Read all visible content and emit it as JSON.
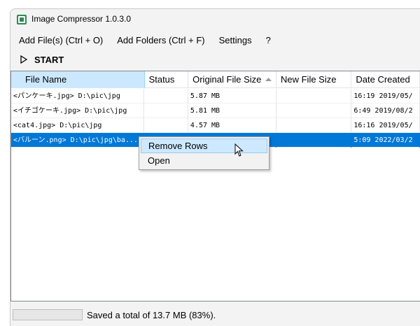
{
  "window": {
    "title": "Image Compressor 1.0.3.0"
  },
  "menu": {
    "items": [
      "Add File(s) (Ctrl + O)",
      "Add Folders (Ctrl + F)",
      "Settings",
      "?"
    ]
  },
  "toolbar": {
    "start_label": "START"
  },
  "table": {
    "columns": [
      "File Name",
      "Status",
      "Original File Size",
      "New File Size",
      "Date Created"
    ],
    "sorted_column": "Original File Size",
    "rows": [
      {
        "name": "<パンケーキ.jpg> D:\\pic\\jpg",
        "status": "",
        "original": "5.87 MB",
        "new": "",
        "date": "16:19 2019/05/"
      },
      {
        "name": "<イチゴケーキ.jpg> D:\\pic\\jpg",
        "status": "",
        "original": "5.81 MB",
        "new": "",
        "date": "6:49 2019/08/2"
      },
      {
        "name": "<cat4.jpg> D:\\pic\\jpg",
        "status": "",
        "original": "4.57 MB",
        "new": "",
        "date": "16:16 2019/05/"
      },
      {
        "name": "<バルーン.png> D:\\pic\\jpg\\ba...",
        "status": "",
        "original": "",
        "new": "",
        "date": "5:09 2022/03/2"
      }
    ],
    "selected_row": 3
  },
  "context_menu": {
    "items": [
      "Remove Rows",
      "Open"
    ],
    "hover_index": 0
  },
  "status": {
    "text": "Saved a total of 13.7 MB (83%).",
    "progress": 0
  },
  "colors": {
    "selection": "#0078d7",
    "header_active": "#cce8ff",
    "menu_hover": "#cde8ff"
  }
}
